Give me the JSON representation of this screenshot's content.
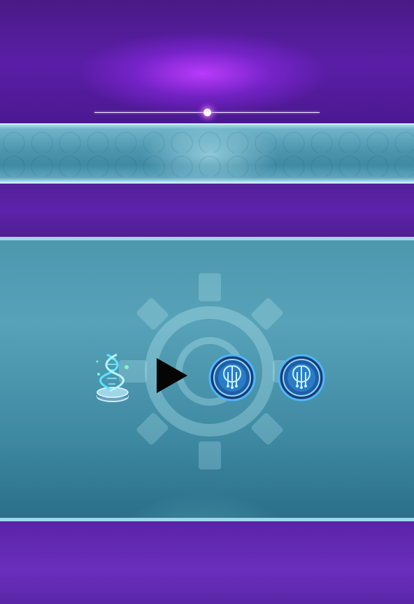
{
  "screen": {
    "name": "dna-upgrade-reward",
    "accent_color": "#8a2be2",
    "panel_color": "#4c95ad"
  },
  "slider": {
    "value_fraction": 0.5
  },
  "reward_flow": {
    "source_item": {
      "icon": "dna-helix-icon"
    },
    "transition_icon": "play-arrow-icon",
    "results": [
      {
        "icon": "circuit-chip-icon"
      },
      {
        "icon": "circuit-chip-icon"
      }
    ]
  },
  "background_icon": "gear-icon"
}
